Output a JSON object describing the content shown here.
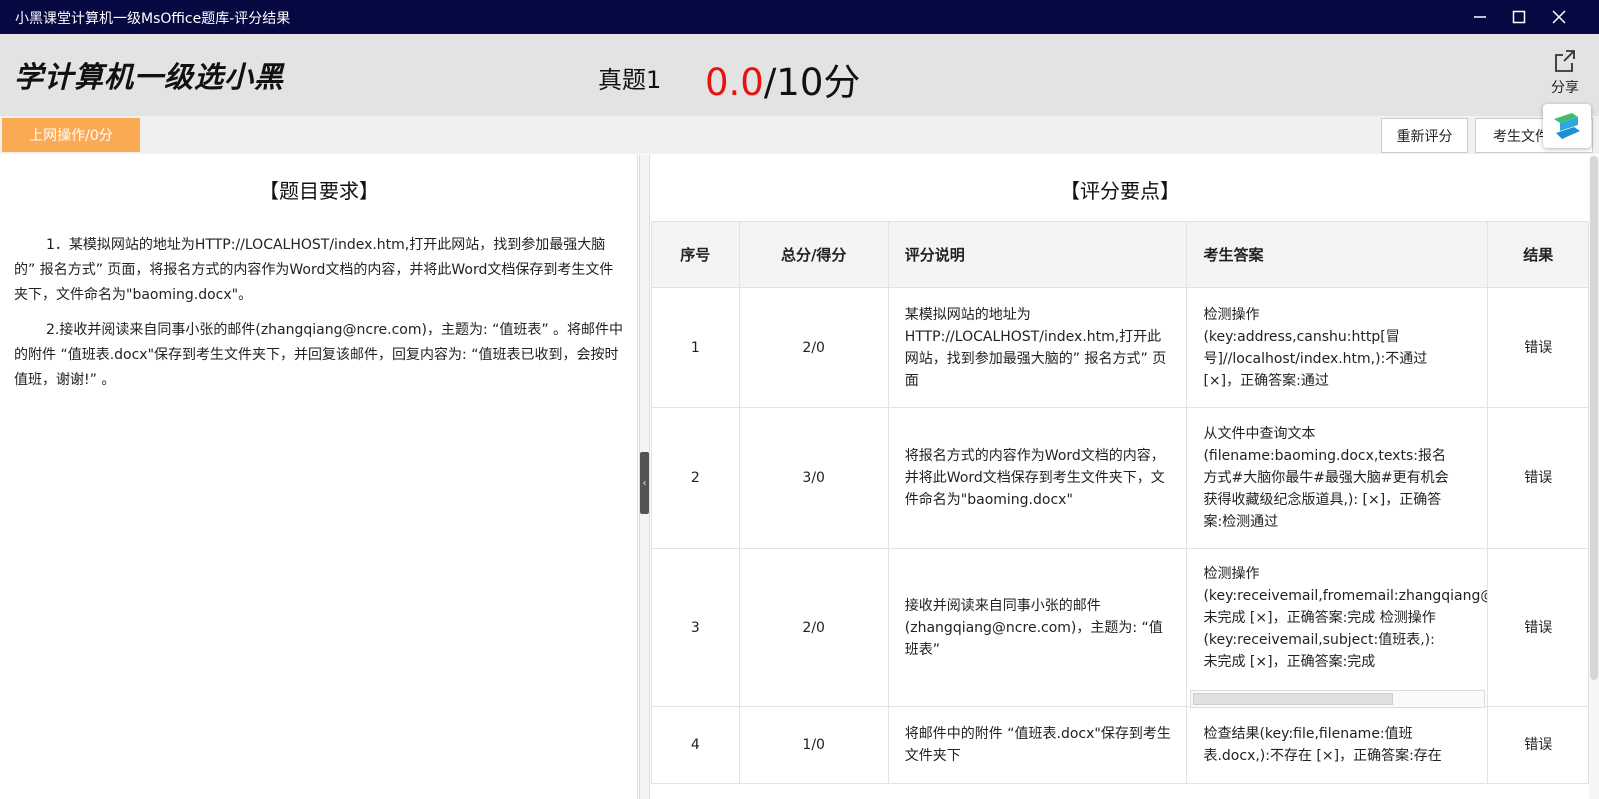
{
  "window": {
    "title": "小黑课堂计算机一级MsOffice题库-评分结果"
  },
  "header": {
    "logo_text": "学计算机一级选小黑",
    "exam_name": "真题1",
    "score_got": "0.0",
    "score_total": "/10分",
    "share_label": "分享"
  },
  "tabs": {
    "active_label": "上网操作/0分",
    "rescore_label": "重新评分",
    "student_folder_label": "考生文件夹"
  },
  "requirements": {
    "title": "【题目要求】",
    "paragraphs": [
      "1．某模拟网站的地址为HTTP://LOCALHOST/index.htm,打开此网站，找到参加最强大脑的” 报名方式” 页面，将报名方式的内容作为Word文档的内容，并将此Word文档保存到考生文件夹下，文件命名为\"baoming.docx\"。",
      "2.接收并阅读来自同事小张的邮件(zhangqiang@ncre.com)，主题为: “值班表” 。将邮件中的附件 “值班表.docx\"保存到考生文件夹下，并回复该邮件，回复内容为: “值班表已收到，会按时值班，谢谢!” 。"
    ]
  },
  "scoring": {
    "title": "【评分要点】",
    "columns": [
      "序号",
      "总分/得分",
      "评分说明",
      "考生答案",
      "结果"
    ],
    "rows": [
      {
        "idx": "1",
        "score": "2/0",
        "desc": "某模拟网站的地址为HTTP://LOCALHOST/index.htm,打开此网站，找到参加最强大脑的” 报名方式” 页面",
        "answer": "检测操作\n(key:address,canshu:http[冒\n号]//localhost/index.htm,):不通过\n[×]，正确答案:通过",
        "result": "错误"
      },
      {
        "idx": "2",
        "score": "3/0",
        "desc": "将报名方式的内容作为Word文档的内容，并将此Word文档保存到考生文件夹下，文件命名为\"baoming.docx\"",
        "answer": "从文件中查询文本\n(filename:baoming.docx,texts:报名\n方式#大脑你最牛#最强大脑#更有机会\n获得收藏级纪念版道具,): [×]，正确答\n案:检测通过",
        "result": "错误"
      },
      {
        "idx": "3",
        "score": "2/0",
        "desc": "接收并阅读来自同事小张的邮件(zhangqiang@ncre.com)，主题为: “值班表”",
        "answer": "检测操作\n(key:receivemail,fromemail:zhangqiang@ncre.com,):\n未完成 [×]，正确答案:完成 检测操作\n(key:receivemail,subject:值班表,):\n未完成 [×]，正确答案:完成",
        "result": "错误"
      },
      {
        "idx": "4",
        "score": "1/0",
        "desc": "将邮件中的附件 “值班表.docx\"保存到考生文件夹下",
        "answer": "检查结果(key:file,filename:值班\n表.docx,):不存在 [×]，正确答案:存在",
        "result": "错误"
      }
    ]
  },
  "colors": {
    "titlebar_bg": "#060842",
    "score_red": "#e8130f",
    "tab_orange": "#fbaa54"
  },
  "icons": [
    "minimize-icon",
    "maximize-icon",
    "close-icon",
    "share-icon",
    "app-logo-icon",
    "chevron-left-icon"
  ]
}
